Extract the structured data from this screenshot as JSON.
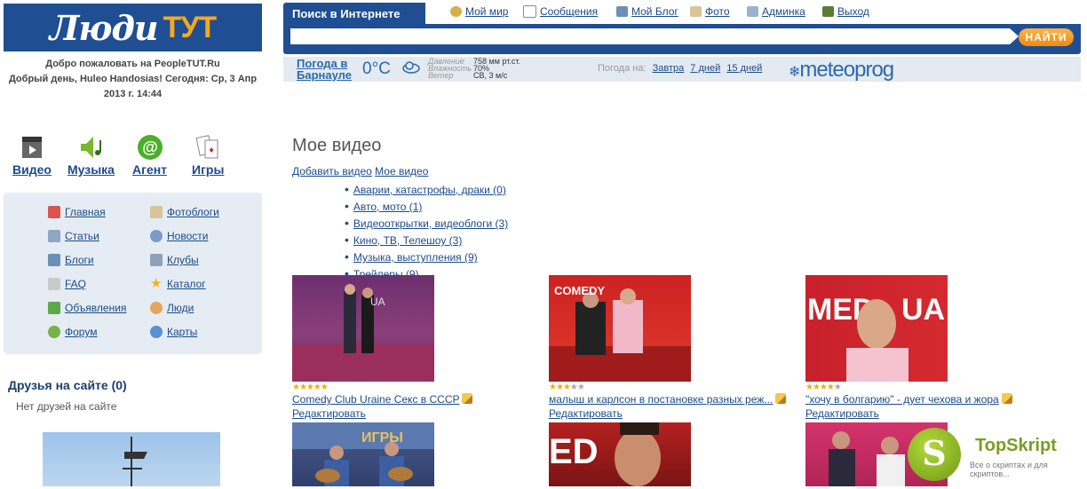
{
  "logo": {
    "part1": "Люди",
    "part2": "ТУТ"
  },
  "welcome": {
    "line1": "Добро пожаловать на PeopleTUT.Ru",
    "line2": "Добрый день, Huleo Handosias! Сегодня: Ср, 3 Апр 2013 г. 14:44"
  },
  "top_icons": [
    {
      "label": "Видео",
      "icon": "film-clapper-icon"
    },
    {
      "label": "Музыка",
      "icon": "speaker-note-icon"
    },
    {
      "label": "Агент",
      "icon": "at-sign-icon"
    },
    {
      "label": "Игры",
      "icon": "playing-cards-icon"
    }
  ],
  "nav": {
    "left": [
      {
        "label": "Главная",
        "icon": "home-icon"
      },
      {
        "label": "Статьи",
        "icon": "article-icon"
      },
      {
        "label": "Блоги",
        "icon": "blog-icon"
      },
      {
        "label": "FAQ",
        "icon": "faq-icon"
      },
      {
        "label": "Объявления",
        "icon": "ads-icon"
      },
      {
        "label": "Форум",
        "icon": "forum-icon"
      }
    ],
    "right": [
      {
        "label": "Фотоблоги",
        "icon": "photo-icon"
      },
      {
        "label": "Новости",
        "icon": "news-icon"
      },
      {
        "label": "Клубы",
        "icon": "clubs-icon"
      },
      {
        "label": "Каталог",
        "icon": "star-icon"
      },
      {
        "label": "Люди",
        "icon": "people-icon"
      },
      {
        "label": "Карты",
        "icon": "globe-icon"
      }
    ]
  },
  "friends": {
    "title": "Друзья на сайте (0)",
    "empty": "Нет друзей на сайте"
  },
  "search": {
    "tab": "Поиск в Интернете",
    "button": "НАЙТИ",
    "value": "",
    "links": [
      {
        "label": "Мой мир",
        "icon": "user-icon"
      },
      {
        "label": "Сообщения",
        "icon": "envelope-icon"
      },
      {
        "label": "Мой Блог",
        "icon": "blog-icon"
      },
      {
        "label": "Фото",
        "icon": "photo-icon"
      },
      {
        "label": "Админка",
        "icon": "admin-icon"
      },
      {
        "label": "Выход",
        "icon": "exit-icon"
      }
    ]
  },
  "weather": {
    "city": "Погода в Барнауле",
    "temp": "0°C",
    "labels": [
      "Давление",
      "Влажность",
      "Ветер"
    ],
    "values": [
      "758 мм рт.ст.",
      "70%",
      "СВ,  3 м/с"
    ],
    "forecast_label": "Погода на:",
    "forecast_links": [
      "Завтра",
      "7 дней",
      "15 дней"
    ],
    "brand": "meteoprog"
  },
  "main": {
    "title": "Мое видео",
    "add_video": "Добавить видео",
    "my_video": "Мое видео",
    "categories": [
      "Аварии, катастрофы, драки (0)",
      "Авто, мото (1)",
      "Видеооткрытки, видеоблоги (3)",
      "Кино, ТВ, Телешоу (3)",
      "Музыка, выступления (9)",
      "Трейлеры (9)"
    ],
    "videos": [
      {
        "title": "Comedy Club Uraine Секс в СССР",
        "rating": 5,
        "edit": "Редактировать"
      },
      {
        "title": "малыш и карлсон в постановке разных реж...",
        "rating": 3,
        "edit": "Редактировать"
      },
      {
        "title": "\"хочу в болгарию\" - дует чехова и жора",
        "rating": 4,
        "edit": "Редактировать"
      }
    ]
  },
  "watermark": {
    "name": "TopSkript",
    "tagline": "Все о скриптах и для скриптов...",
    "letter": "S"
  }
}
